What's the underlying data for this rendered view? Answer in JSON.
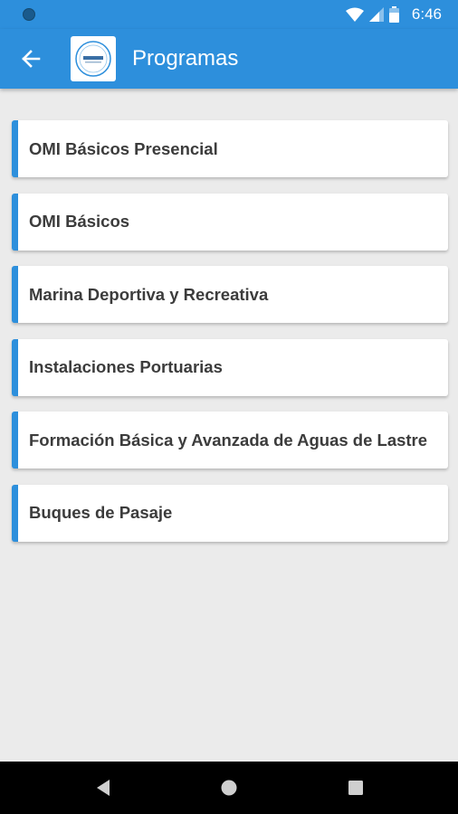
{
  "status_bar": {
    "time": "6:46"
  },
  "app_bar": {
    "title": "Programas"
  },
  "programs": [
    {
      "label": "OMI Básicos Presencial"
    },
    {
      "label": "OMI Básicos"
    },
    {
      "label": "Marina Deportiva y Recreativa"
    },
    {
      "label": "Instalaciones Portuarias"
    },
    {
      "label": "Formación Básica y Avanzada de Aguas de Lastre"
    },
    {
      "label": "Buques de Pasaje"
    }
  ],
  "colors": {
    "primary": "#2d8fdc",
    "background": "#ebebeb",
    "text": "#3c3c3c"
  },
  "icons": {
    "back": "arrow-left",
    "wifi": "wifi",
    "signal": "cellular-signal",
    "battery": "battery",
    "nav_back": "triangle-back",
    "nav_home": "circle-home",
    "nav_recents": "square-recents"
  }
}
